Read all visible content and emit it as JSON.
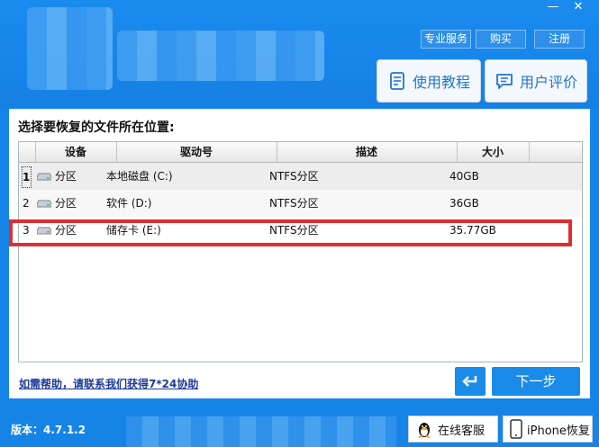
{
  "window": {
    "minimize_glyph": "—",
    "close_glyph": "✕"
  },
  "top_menu": {
    "service": "专业服务",
    "buy": "购买",
    "register": "注册"
  },
  "actions": {
    "tutorial": "使用教程",
    "review": "用户评价"
  },
  "prompt": "选择要恢复的文件所在位置:",
  "table": {
    "columns": [
      "设备",
      "驱动号",
      "描述",
      "大小"
    ],
    "rows": [
      {
        "index": "1",
        "device": "分区",
        "drive": "本地磁盘 (C:)",
        "description": "NTFS分区",
        "size": "40GB"
      },
      {
        "index": "2",
        "device": "分区",
        "drive": "软件 (D:)",
        "description": "NTFS分区",
        "size": "36GB"
      },
      {
        "index": "3",
        "device": "分区",
        "drive": "储存卡 (E:)",
        "description": "NTFS分区",
        "size": "35.77GB"
      }
    ]
  },
  "help_link": "如需帮助，请联系我们获得7*24协助",
  "next_button": "下一步",
  "version": "版本：4.7.1.2",
  "footer": {
    "online_service": "在线客服",
    "iphone_recovery": "iPhone恢复"
  },
  "colors": {
    "background": "#1683e6",
    "highlight": "#e02d2d",
    "button": "#1a8be8"
  }
}
